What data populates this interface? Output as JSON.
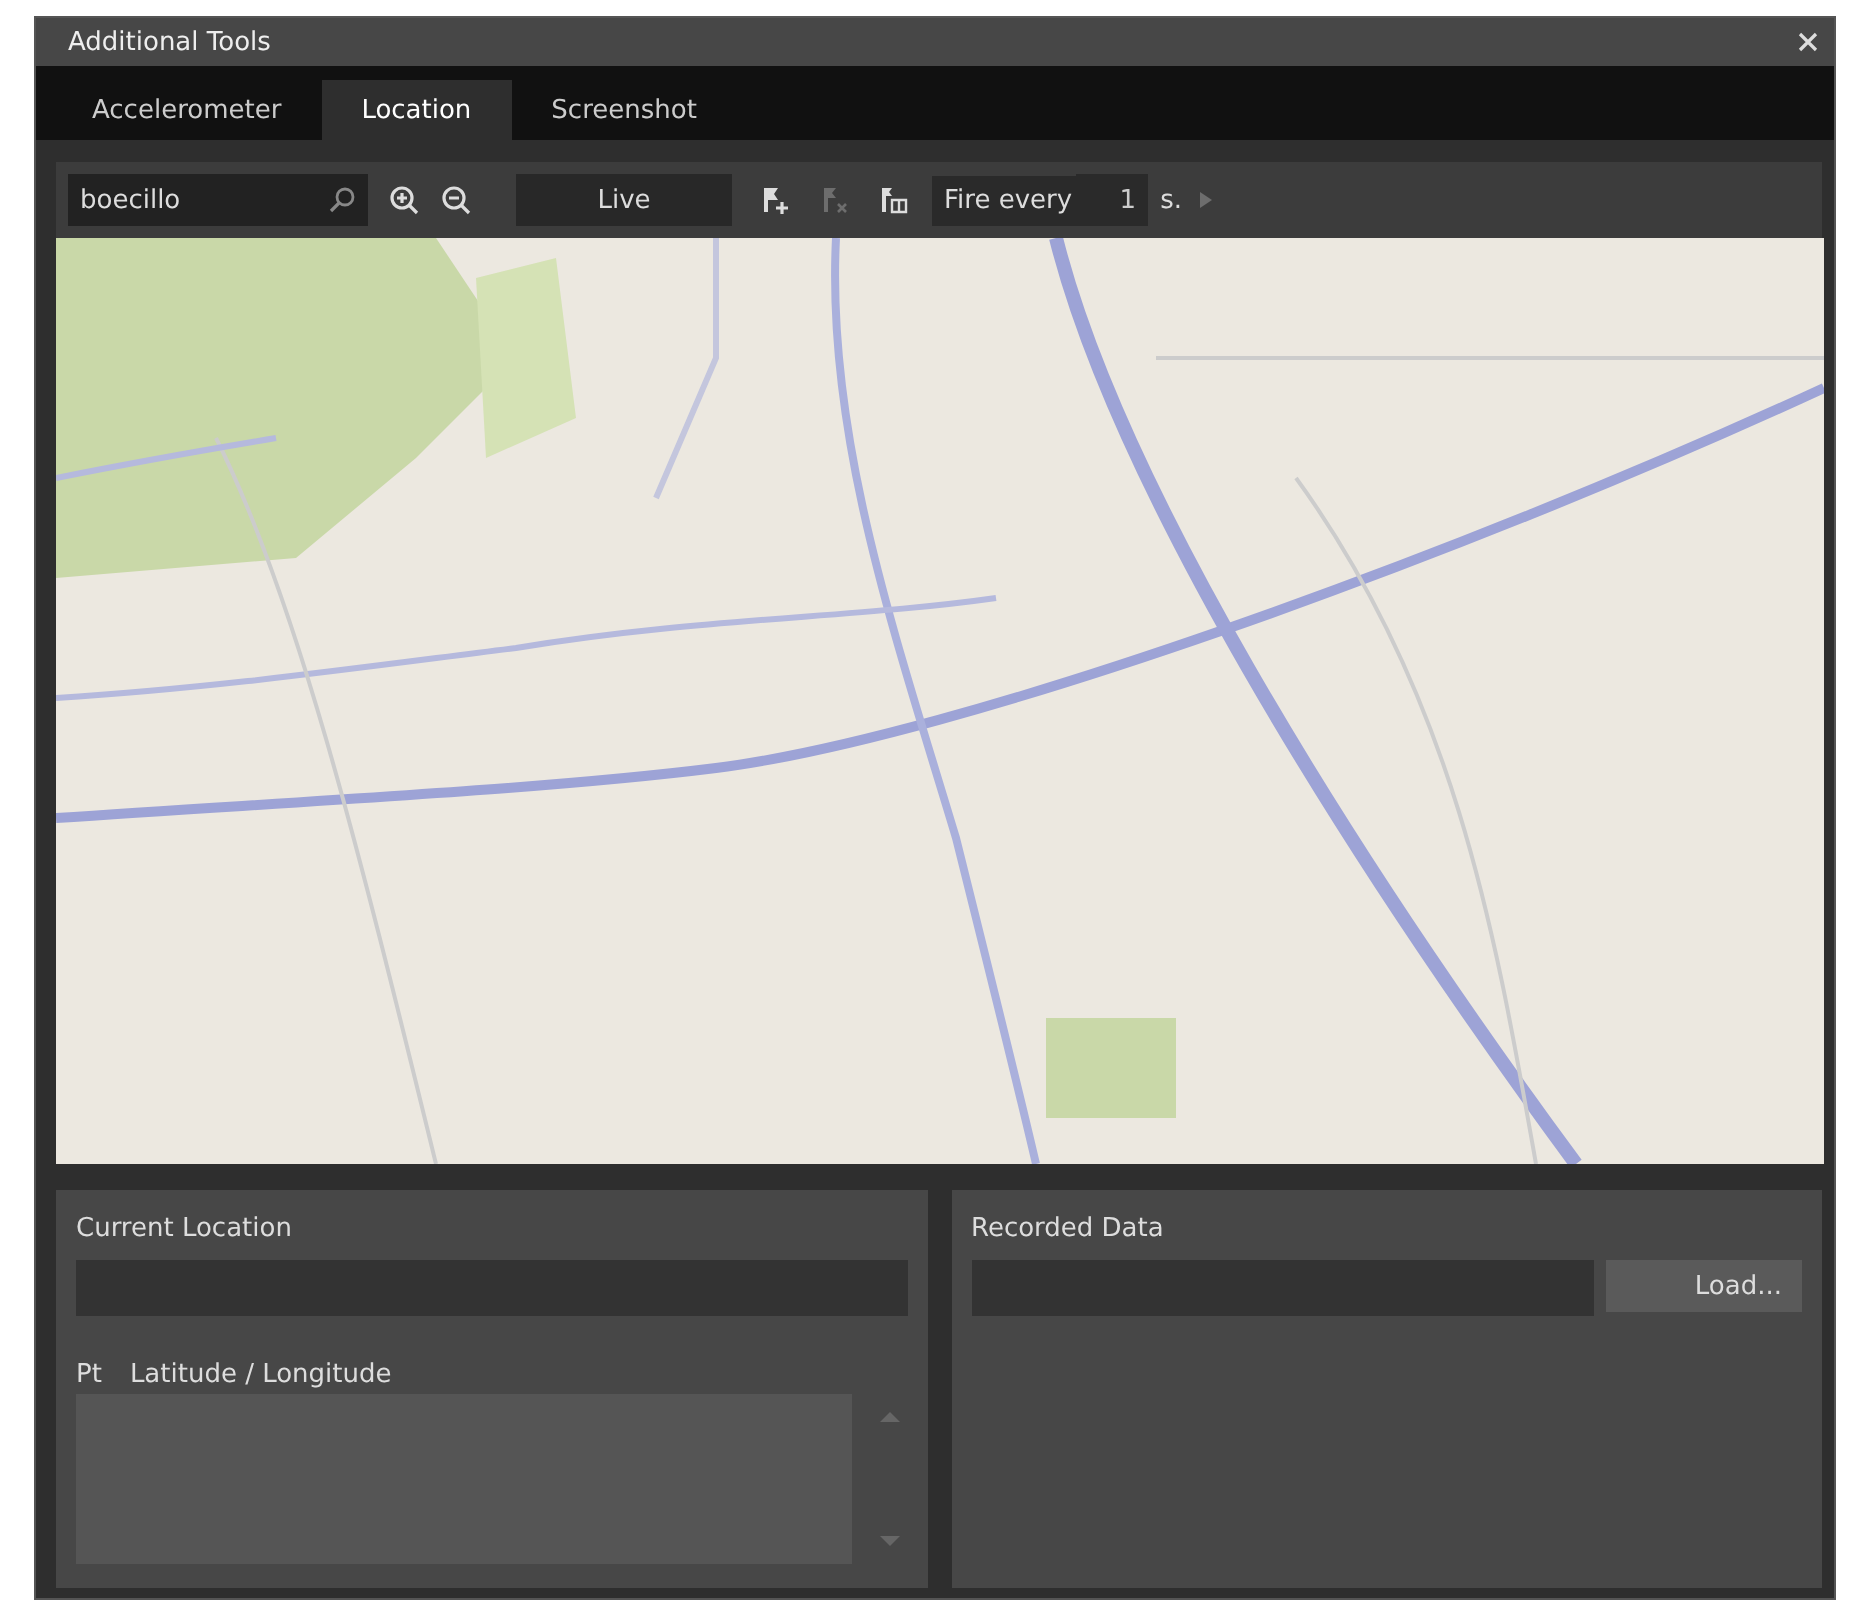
{
  "window": {
    "title": "Additional Tools"
  },
  "tabs": [
    {
      "label": "Accelerometer",
      "selected": false
    },
    {
      "label": "Location",
      "selected": true
    },
    {
      "label": "Screenshot",
      "selected": false
    }
  ],
  "toolbar": {
    "search": {
      "value": "boecillo"
    },
    "live_button": "Live",
    "pin_tools": [
      {
        "kind": "add",
        "disabled": false
      },
      {
        "kind": "remove",
        "disabled": true
      },
      {
        "kind": "clear",
        "disabled": false
      }
    ],
    "fire_label": "Fire every",
    "interval": {
      "value": "1"
    },
    "unit": "s.",
    "play": {
      "disabled": true
    }
  },
  "current_location": {
    "title": "Current Location",
    "columns": [
      "Pt",
      "Latitude / Longitude"
    ]
  },
  "recorded_data": {
    "title": "Recorded Data",
    "load_button": "Load..."
  }
}
